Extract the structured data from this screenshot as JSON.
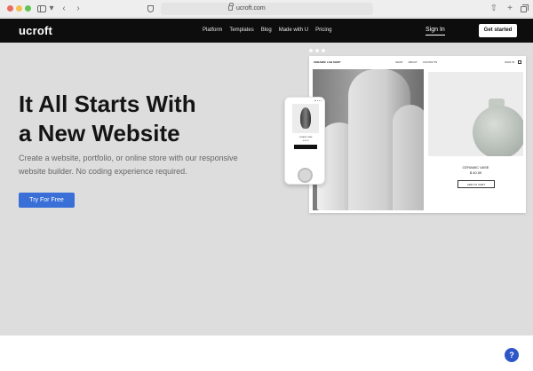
{
  "browser": {
    "url": "ucroft.com"
  },
  "nav": {
    "logo": "ucroft",
    "menu": [
      "Platform",
      "Templates",
      "Blog",
      "Made with U",
      "Pricing"
    ],
    "sign_in": "Sign In",
    "get_started": "Get started"
  },
  "hero": {
    "headline_line1": "It All Starts With",
    "headline_line2": "a New Website",
    "subtext": "Create a website, portfolio, or online store with our responsive website builder. No coding experience required.",
    "cta": "Try For Free"
  },
  "mockup": {
    "shop_name": "CERAMIC LAB SHOP",
    "nav": [
      "SHOP",
      "ABOUT",
      "CONTACTS"
    ],
    "sign_in": "SIGN IN",
    "product_name": "CERAMIC VASE",
    "product_price": "$ 40.00",
    "add_to_cart": "ADD TO CART"
  },
  "help": {
    "label": "?"
  },
  "colors": {
    "nav_bg": "#0d0d0d",
    "hero_bg": "#dddddd",
    "accent": "#3a6fd8",
    "help_bubble": "#2d56c7"
  }
}
